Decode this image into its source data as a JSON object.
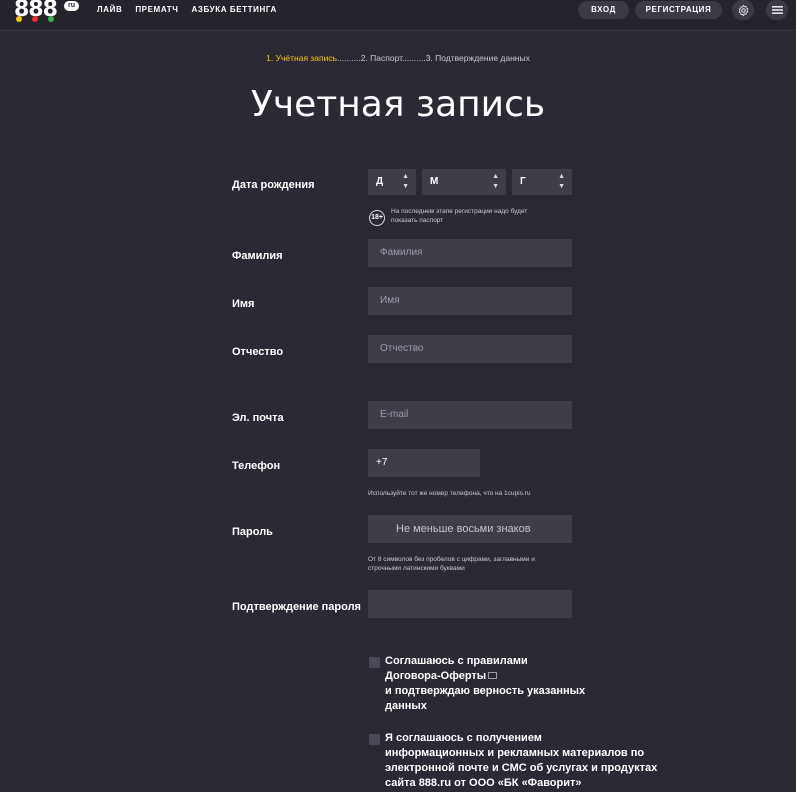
{
  "header": {
    "logo": {
      "text": "888",
      "suffix": "ru"
    },
    "nav": [
      "ЛАЙВ",
      "ПРЕМАТЧ",
      "АЗБУКА БЕТТИНГА"
    ],
    "login_label": "ВХОД",
    "register_label": "РЕГИСТРАЦИЯ"
  },
  "steps": {
    "step1": "1. Учётная запись",
    "sep1": "..........",
    "step2": "2. Паспорт",
    "sep2": "..........",
    "step3": "3. Подтверждение данных"
  },
  "title": "Учетная запись",
  "birth": {
    "label": "Дата рождения",
    "day": "Д",
    "month": "М",
    "year": "Г",
    "badge": "18+",
    "hint_line1": "На последнем этапе регистрации надо будет",
    "hint_line2": "показать паспорт"
  },
  "lastname": {
    "label": "Фамилия",
    "placeholder": "Фамилия"
  },
  "firstname": {
    "label": "Имя",
    "placeholder": "Имя"
  },
  "patronymic": {
    "label": "Отчество",
    "placeholder": "Отчество"
  },
  "email": {
    "label": "Эл. почта",
    "placeholder": "E-mail"
  },
  "phone": {
    "label": "Телефон",
    "value": "+7",
    "hint": "Используйте тот же номер телефона, что на 1cupis.ru"
  },
  "password": {
    "label": "Пароль",
    "placeholder": "Не меньше восьми знаков",
    "hint_line1": "От 8 символов без пробелов с цифрами, заглавными и",
    "hint_line2": "строчными латинскими буквами"
  },
  "password_confirm": {
    "label": "Подтверждение пароля",
    "placeholder": ""
  },
  "agree_terms": {
    "line1": "Соглашаюсь с правилами",
    "link": "Договора-Оферты",
    "line3": "и подтверждаю верность указанных",
    "line4": "данных"
  },
  "agree_marketing": {
    "line1": "Я соглашаюсь с получением",
    "line2": "информационных и рекламных материалов по",
    "line3": "электронной почте и СМС об услугах и продуктах",
    "line4": "сайта 888.ru от ООО «БК «Фаворит»"
  },
  "colors": {
    "background": "#2b2a34",
    "header": "#25242c",
    "field": "#3e3d48",
    "accent": "#f5c518"
  },
  "icons": [
    "gear-icon",
    "menu-icon",
    "link-icon",
    "age-18-icon"
  ]
}
